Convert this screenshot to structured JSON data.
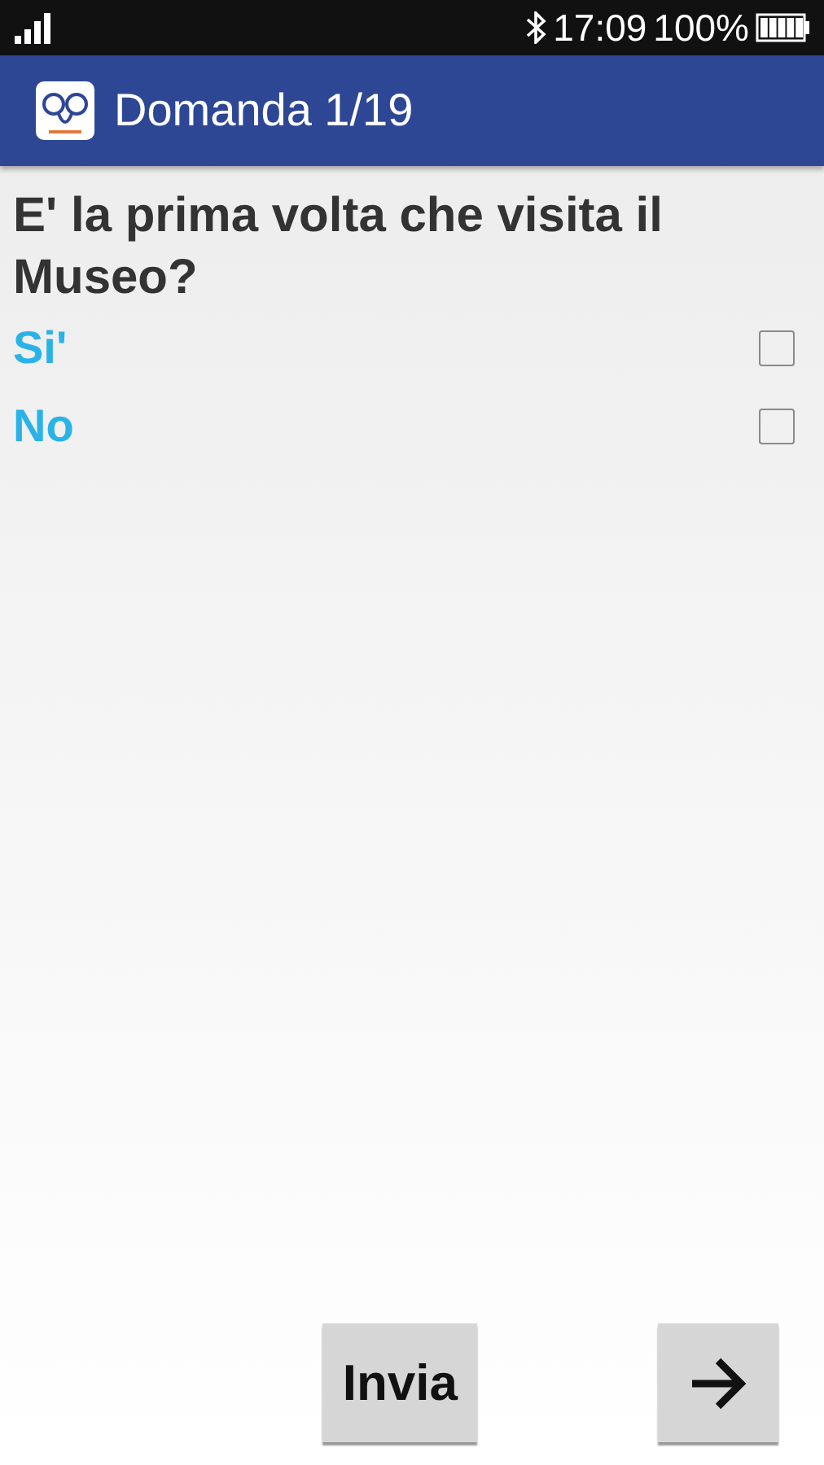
{
  "status_bar": {
    "time": "17:09",
    "battery": "100%"
  },
  "app_bar": {
    "title": "Domanda 1/19"
  },
  "question": "E' la prima volta che visita il Museo?",
  "options": [
    {
      "label": "Si'",
      "checked": false
    },
    {
      "label": "No",
      "checked": false
    }
  ],
  "buttons": {
    "submit": "Invia"
  }
}
